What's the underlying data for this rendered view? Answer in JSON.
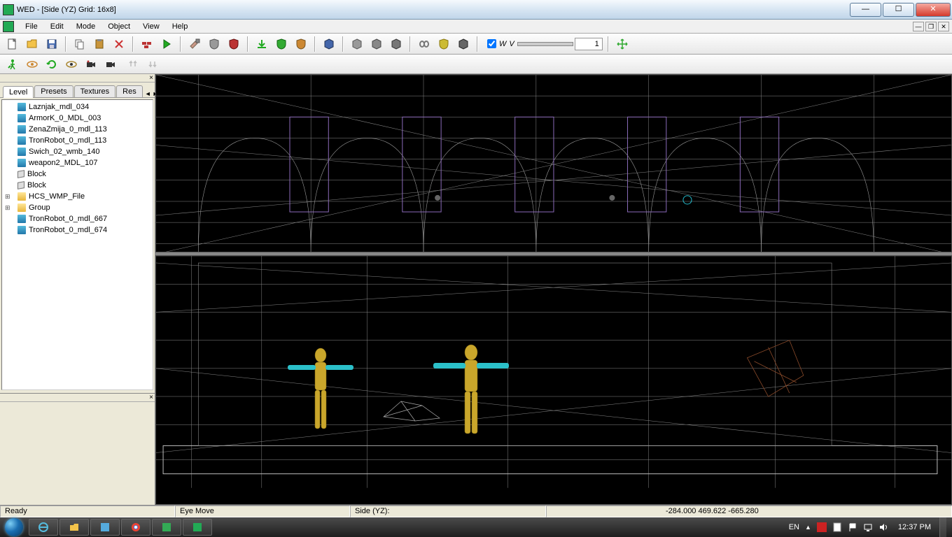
{
  "window": {
    "title": "WED - [Side (YZ) Grid: 16x8]",
    "buttons": {
      "min": "—",
      "max": "☐",
      "close": "✕"
    },
    "mdi": {
      "min": "—",
      "restore": "❐",
      "close": "✕"
    }
  },
  "menu": {
    "items": [
      "File",
      "Edit",
      "Mode",
      "Object",
      "View",
      "Help"
    ]
  },
  "toolbar1": {
    "wv": {
      "checked": true,
      "label_w": "W",
      "label_v": "V",
      "value": "1"
    }
  },
  "side": {
    "tabs": [
      "Level",
      "Presets",
      "Textures",
      "Res"
    ],
    "active_tab": 0,
    "tree": [
      {
        "icon": "mdl",
        "label": "Laznjak_mdl_034"
      },
      {
        "icon": "mdl",
        "label": "ArmorK_0_MDL_003"
      },
      {
        "icon": "mdl",
        "label": "ZenaZmija_0_mdl_113"
      },
      {
        "icon": "mdl",
        "label": "TronRobot_0_mdl_113"
      },
      {
        "icon": "mdl",
        "label": "Swich_02_wmb_140"
      },
      {
        "icon": "mdl",
        "label": "weapon2_MDL_107"
      },
      {
        "icon": "cube",
        "label": "Block"
      },
      {
        "icon": "cube",
        "label": "Block"
      },
      {
        "icon": "folder",
        "label": "HCS_WMP_File",
        "expand": true
      },
      {
        "icon": "folder",
        "label": "Group",
        "expand": true
      },
      {
        "icon": "mdl",
        "label": "TronRobot_0_mdl_667"
      },
      {
        "icon": "mdl",
        "label": "TronRobot_0_mdl_674"
      }
    ]
  },
  "status": {
    "ready": "Ready",
    "mode": "Eye Move",
    "view": "Side (YZ):",
    "coords": "-284.000 469.622 -665.280"
  },
  "taskbar": {
    "lang": "EN",
    "tray_up": "▲",
    "clock": "12:37 PM"
  }
}
